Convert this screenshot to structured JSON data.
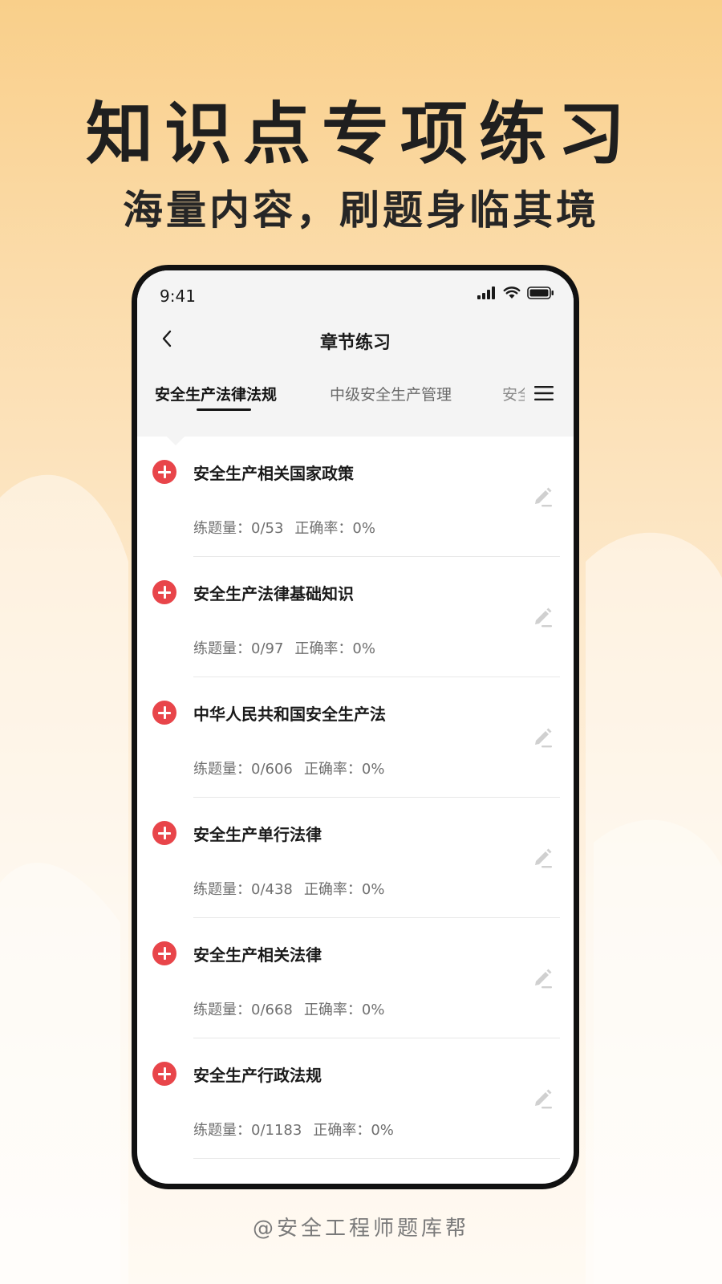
{
  "hero": {
    "title": "知识点专项练习",
    "subtitle": "海量内容，刷题身临其境"
  },
  "status_bar": {
    "time": "9:41",
    "icons": [
      "signal-icon",
      "wifi-icon",
      "battery-icon"
    ]
  },
  "nav": {
    "title": "章节练习",
    "back_icon": "chevron-left-icon"
  },
  "tabs": [
    {
      "label": "安全生产法律法规",
      "active": true
    },
    {
      "label": "中级安全生产管理",
      "active": false
    },
    {
      "label": "安全",
      "active": false
    }
  ],
  "tab_menu_icon": "menu-icon",
  "stats_labels": {
    "count": "练题量：",
    "accuracy": "正确率："
  },
  "items": [
    {
      "title": "安全生产相关国家政策",
      "count": "0/53",
      "accuracy": "0%"
    },
    {
      "title": "安全生产法律基础知识",
      "count": "0/97",
      "accuracy": "0%"
    },
    {
      "title": "中华人民共和国安全生产法",
      "count": "0/606",
      "accuracy": "0%"
    },
    {
      "title": "安全生产单行法律",
      "count": "0/438",
      "accuracy": "0%"
    },
    {
      "title": "安全生产相关法律",
      "count": "0/668",
      "accuracy": "0%"
    },
    {
      "title": "安全生产行政法规",
      "count": "0/1183",
      "accuracy": "0%"
    }
  ],
  "watermark": "@安全工程师题库帮",
  "colors": {
    "accent": "#e8454a",
    "bg_top": "#f9cf8a",
    "bg_bottom": "#fffaf3"
  }
}
